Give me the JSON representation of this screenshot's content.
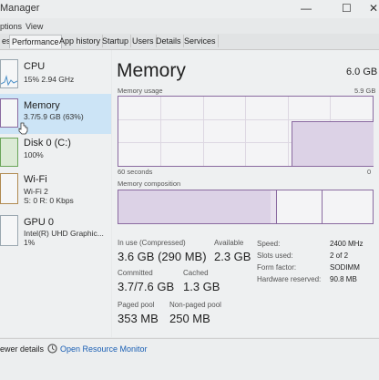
{
  "window": {
    "title": "Manager"
  },
  "window_controls": {
    "minimize": "—",
    "maximize": "☐",
    "close": "✕"
  },
  "menu": {
    "items": [
      "ptions",
      "View"
    ]
  },
  "tabs": [
    {
      "label": "es",
      "active": false
    },
    {
      "label": "Performance",
      "active": true
    },
    {
      "label": "App history",
      "active": false
    },
    {
      "label": "Startup",
      "active": false
    },
    {
      "label": "Users",
      "active": false
    },
    {
      "label": "Details",
      "active": false
    },
    {
      "label": "Services",
      "active": false
    }
  ],
  "sidebar": {
    "items": [
      {
        "title": "CPU",
        "subtitle": "15% 2.94 GHz"
      },
      {
        "title": "Memory",
        "subtitle": "3.7/5.9 GB (63%)",
        "selected": true
      },
      {
        "title": "Disk 0 (C:)",
        "subtitle": "100%"
      },
      {
        "title": "Wi-Fi",
        "subtitle": "Wi-Fi 2",
        "subtitle2": "S: 0 R: 0 Kbps"
      },
      {
        "title": "GPU 0",
        "subtitle": "Intel(R) UHD Graphic...",
        "subtitle2": "1%"
      }
    ]
  },
  "main": {
    "title": "Memory",
    "total": "6.0 GB",
    "usage_label": "Memory usage",
    "usage_max": "5.9 GB",
    "usage_x_left": "60 seconds",
    "usage_x_right": "0",
    "usage_level": 0.63,
    "composition_label": "Memory composition",
    "composition": {
      "in_use": 0.6,
      "modified": 0.02,
      "standby": 0.18
    }
  },
  "stats": {
    "in_use_label": "In use (Compressed)",
    "in_use_value": "3.6 GB (290 MB)",
    "available_label": "Available",
    "available_value": "2.3 GB",
    "committed_label": "Committed",
    "committed_value": "3.7/7.6 GB",
    "cached_label": "Cached",
    "cached_value": "1.3 GB",
    "paged_label": "Paged pool",
    "paged_value": "353 MB",
    "nonpaged_label": "Non-paged pool",
    "nonpaged_value": "250 MB"
  },
  "specs": {
    "speed_label": "Speed:",
    "speed_value": "2400 MHz",
    "slots_label": "Slots used:",
    "slots_value": "2 of 2",
    "form_label": "Form factor:",
    "form_value": "SODIMM",
    "reserved_label": "Hardware reserved:",
    "reserved_value": "90.8 MB"
  },
  "footer": {
    "fewer_details": "ewer details",
    "open_monitor": "Open Resource Monitor"
  },
  "colors": {
    "accent": "#8a6aa0",
    "selection": "#cce4f6",
    "link": "#1a5fb4"
  }
}
